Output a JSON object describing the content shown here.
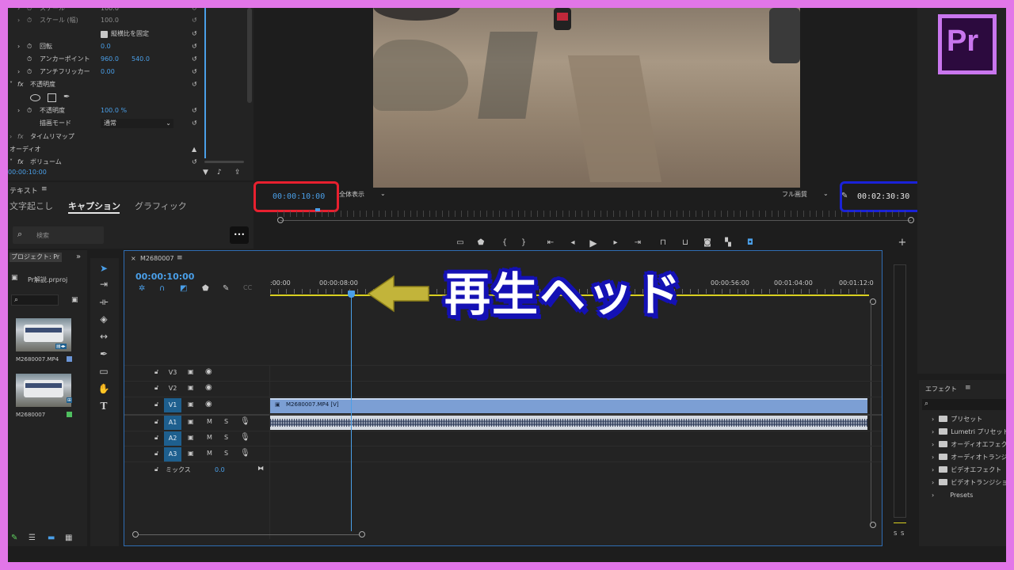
{
  "effect_controls": {
    "scale_label": "スケール",
    "scale_value": "100.0",
    "scale_width_label": "スケール (幅)",
    "scale_width_value": "100.0",
    "uniform_scale_label": "縦横比を固定",
    "rotation_label": "回転",
    "rotation_value": "0.0",
    "anchor_label": "アンカーポイント",
    "anchor_x": "960.0",
    "anchor_y": "540.0",
    "flicker_label": "アンチフリッカー",
    "flicker_value": "0.00",
    "opacity_section": "不透明度",
    "opacity_label": "不透明度",
    "opacity_value": "100.0 %",
    "blend_label": "描画モード",
    "blend_value": "通常",
    "time_remap_label": "タイムリマップ",
    "audio_label": "オーディオ",
    "volume_label": "ボリューム",
    "timecode": "00:00:10:00"
  },
  "text_panel": {
    "title": "テキスト",
    "tabs": [
      "文字起こし",
      "キャプション",
      "グラフィック"
    ],
    "search_placeholder": "検索",
    "more_button": "•••"
  },
  "project": {
    "title": "プロジェクト: Pr",
    "file_name": "Pr解説.prproj",
    "items": [
      "M2680007.MP4",
      "M2680007"
    ]
  },
  "program_monitor": {
    "current_time": "00:00:10:00",
    "fit_label": "全体表示",
    "quality_label": "フル画質",
    "duration": "00:02:30:30"
  },
  "timeline": {
    "sequence_name": "M2680007",
    "timecode": "00:00:10:00",
    "ruler": [
      ":00:00",
      "00:00:08:00",
      "00:00:56:00",
      "00:01:04:00",
      "00:01:12:0"
    ],
    "video_tracks": [
      "V3",
      "V2",
      "V1"
    ],
    "audio_tracks": [
      "A1",
      "A2",
      "A3"
    ],
    "mute_label": "M",
    "solo_label": "S",
    "mix_label": "ミックス",
    "mix_value": "0.0",
    "clip_label": "M2680007.MP4 [V]"
  },
  "annotation": {
    "text": "再生ヘッド"
  },
  "effects_panel": {
    "title": "エフェクト",
    "items": [
      "プリセット",
      "Lumetri プリセット",
      "オーディオエフェク",
      "オーディオトランジ",
      "ビデオエフェクト",
      "ビデオトランジショ",
      "Presets"
    ]
  },
  "app_logo": "Pr",
  "meter_labels": [
    "S",
    "S"
  ],
  "colors": {
    "accent_blue": "#4a9fe8",
    "track_selected": "#1e5f8e",
    "clip_video": "#7c9fd4",
    "red_box": "#e8202f",
    "blue_box": "#1a22d8",
    "logo_purple": "#c976ee",
    "logo_bg": "#2c0a3e"
  }
}
